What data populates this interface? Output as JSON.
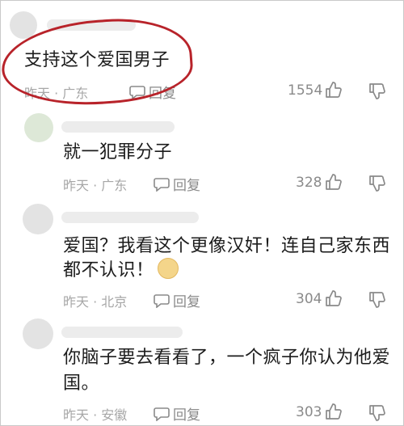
{
  "comments": [
    {
      "text": "支持这个爱国男子",
      "meta": "昨天 · 广东",
      "reply": "回复",
      "likes": "1554"
    },
    {
      "text": "就一犯罪分子",
      "meta": "昨天 · 广东",
      "reply": "回复",
      "likes": "328"
    },
    {
      "text": "爱国？我看这个更像汉奸！连自己家东西",
      "text2": "都不认识！",
      "meta": "昨天 · 北京",
      "reply": "回复",
      "likes": "304"
    },
    {
      "text": "你脑子要去看看了，一个疯子你认为他爱",
      "text2": "国。",
      "meta": "昨天 · 安徽",
      "reply": "回复",
      "likes": "303"
    }
  ],
  "icons": {
    "like": "thumbs-up-icon",
    "dislike": "thumbs-down-icon",
    "reply": "speech-bubble-icon",
    "emoji": "doge-emoji-icon"
  },
  "colors": {
    "annotation_circle": "#b8232a"
  }
}
